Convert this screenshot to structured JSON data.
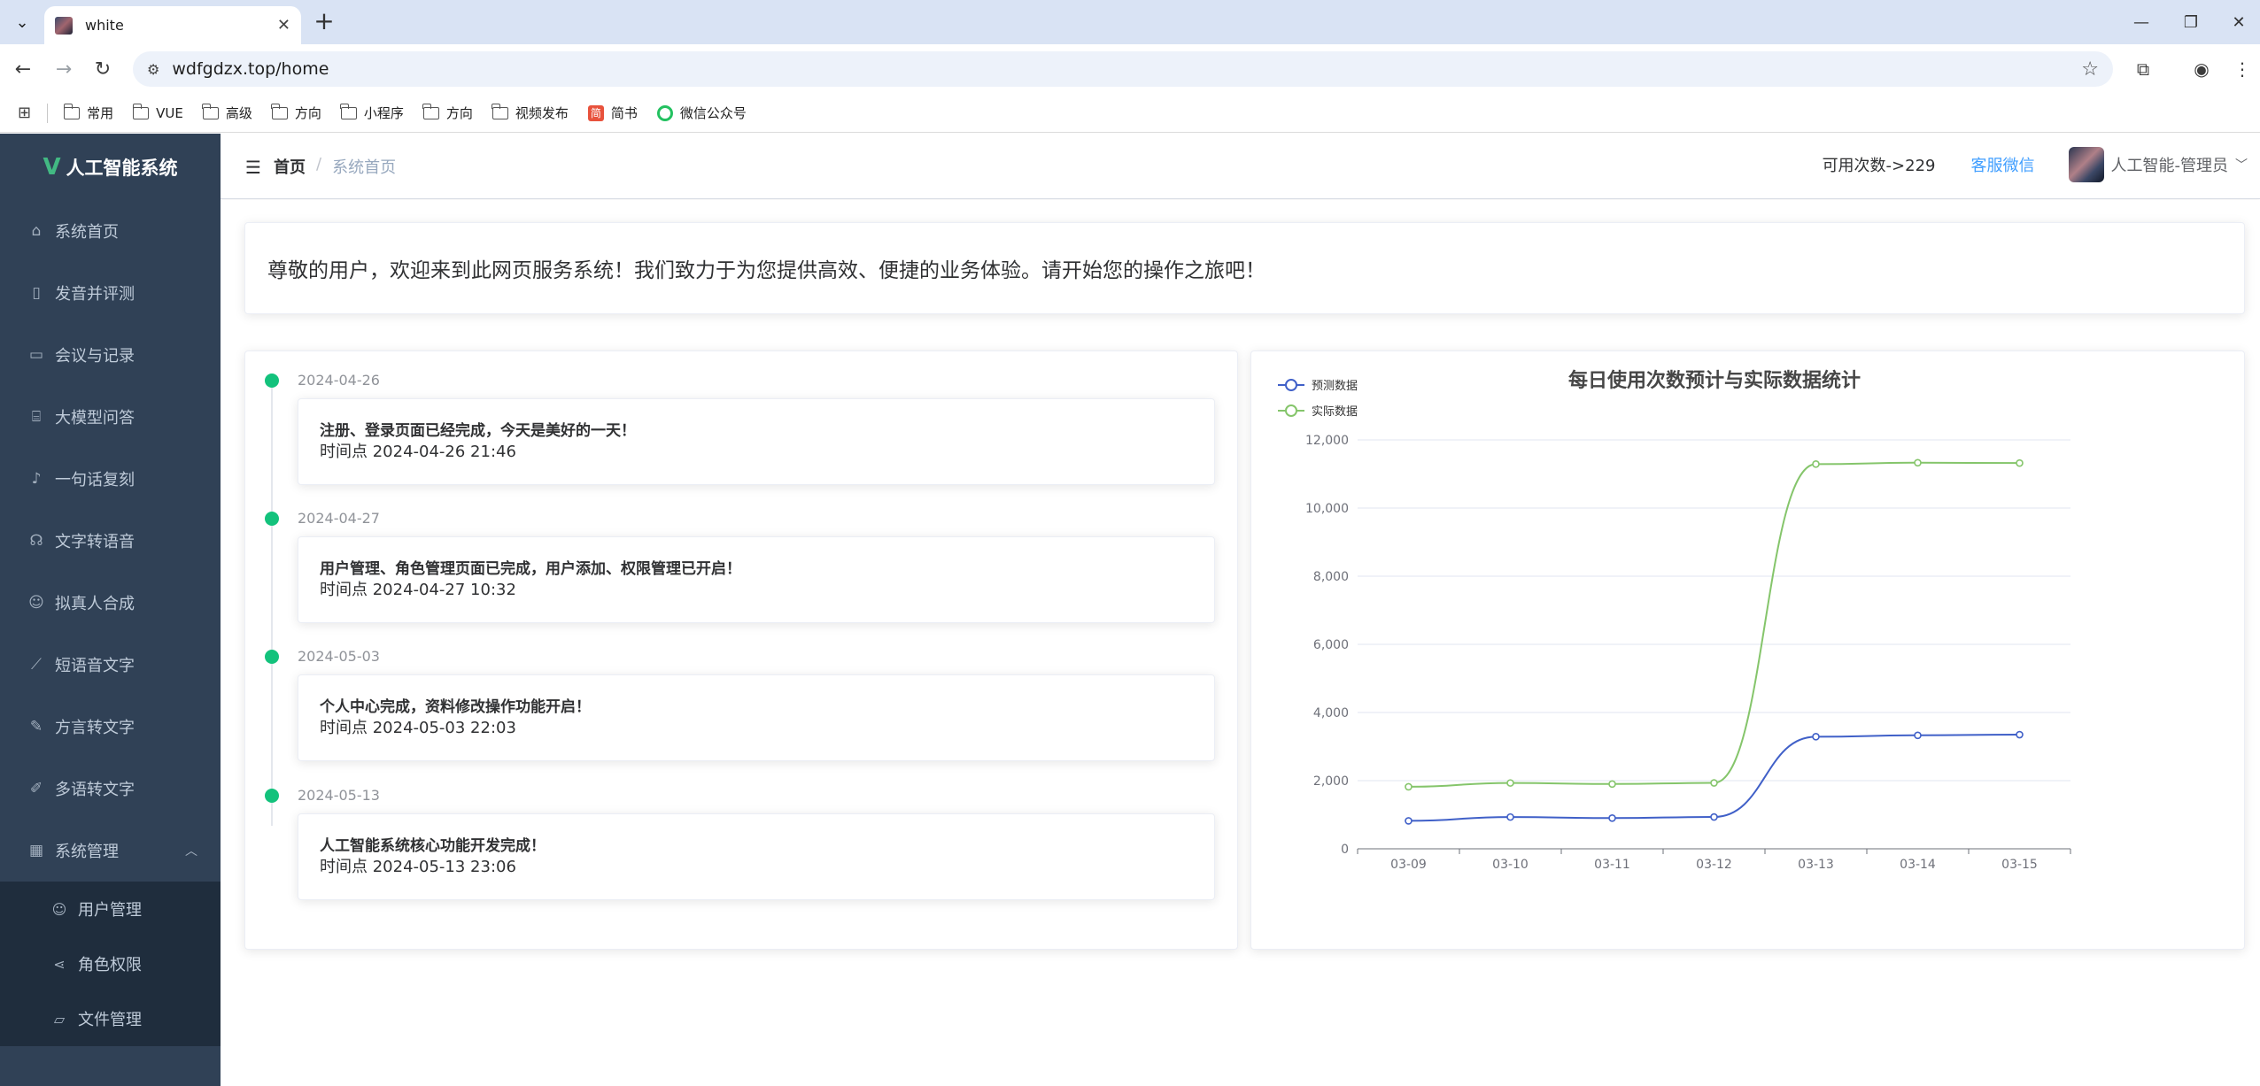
{
  "browser": {
    "tab_title": "white",
    "url": "wdfgdzx.top/home",
    "bookmarks": [
      "常用",
      "VUE",
      "高级",
      "方向",
      "小程序",
      "方向",
      "视频发布",
      "简书",
      "微信公众号"
    ]
  },
  "sidebar": {
    "logo_text": "人工智能系统",
    "items": [
      {
        "label": "系统首页",
        "icon": "home-icon"
      },
      {
        "label": "发音并评测",
        "icon": "book-icon"
      },
      {
        "label": "会议与记录",
        "icon": "monitor-icon"
      },
      {
        "label": "大模型问答",
        "icon": "lock-icon"
      },
      {
        "label": "一句话复刻",
        "icon": "microphone-icon"
      },
      {
        "label": "文字转语音",
        "icon": "headset-icon"
      },
      {
        "label": "拟真人合成",
        "icon": "user-icon"
      },
      {
        "label": "短语音文字",
        "icon": "chart-icon"
      },
      {
        "label": "方言转文字",
        "icon": "pen-icon"
      },
      {
        "label": "多语转文字",
        "icon": "edit-icon"
      }
    ],
    "group": {
      "label": "系统管理",
      "icon": "grid-icon"
    },
    "sub_items": [
      {
        "label": "用户管理",
        "icon": "user-icon"
      },
      {
        "label": "角色权限",
        "icon": "share-icon"
      },
      {
        "label": "文件管理",
        "icon": "folder-icon"
      }
    ]
  },
  "header": {
    "breadcrumb_home": "首页",
    "breadcrumb_sep": "/",
    "breadcrumb_current": "系统首页",
    "remaining": "可用次数->229",
    "service": "客服微信",
    "user": "人工智能-管理员"
  },
  "welcome": "尊敬的用户，欢迎来到此网页服务系统！我们致力于为您提供高效、便捷的业务体验。请开始您的操作之旅吧！",
  "timeline": [
    {
      "date": "2024-04-26",
      "text": "注册、登录页面已经完成，今天是美好的一天！",
      "time": "时间点 2024-04-26 21:46"
    },
    {
      "date": "2024-04-27",
      "text": "用户管理、角色管理页面已完成，用户添加、权限管理已开启！",
      "time": "时间点 2024-04-27 10:32"
    },
    {
      "date": "2024-05-03",
      "text": "个人中心完成，资料修改操作功能开启！",
      "time": "时间点 2024-05-03 22:03"
    },
    {
      "date": "2024-05-13",
      "text": "人工智能系统核心功能开发完成！",
      "time": "时间点 2024-05-13 23:06"
    }
  ],
  "chart_data": {
    "type": "line",
    "title": "每日使用次数预计与实际数据统计",
    "categories": [
      "03-09",
      "03-10",
      "03-11",
      "03-12",
      "03-13",
      "03-14",
      "03-15"
    ],
    "series": [
      {
        "name": "预测数据",
        "color": "#4060c8",
        "values": [
          820,
          932,
          901,
          934,
          3290,
          3330,
          3350
        ]
      },
      {
        "name": "实际数据",
        "color": "#85c56b",
        "values": [
          1820,
          1932,
          1901,
          1934,
          11290,
          11330,
          11320
        ]
      }
    ],
    "ylim": [
      0,
      12000
    ],
    "yticks": [
      "0",
      "2,000",
      "4,000",
      "6,000",
      "8,000",
      "10,000",
      "12,000"
    ],
    "smooth": true,
    "grid": "horizontal",
    "legend": "top-left"
  }
}
